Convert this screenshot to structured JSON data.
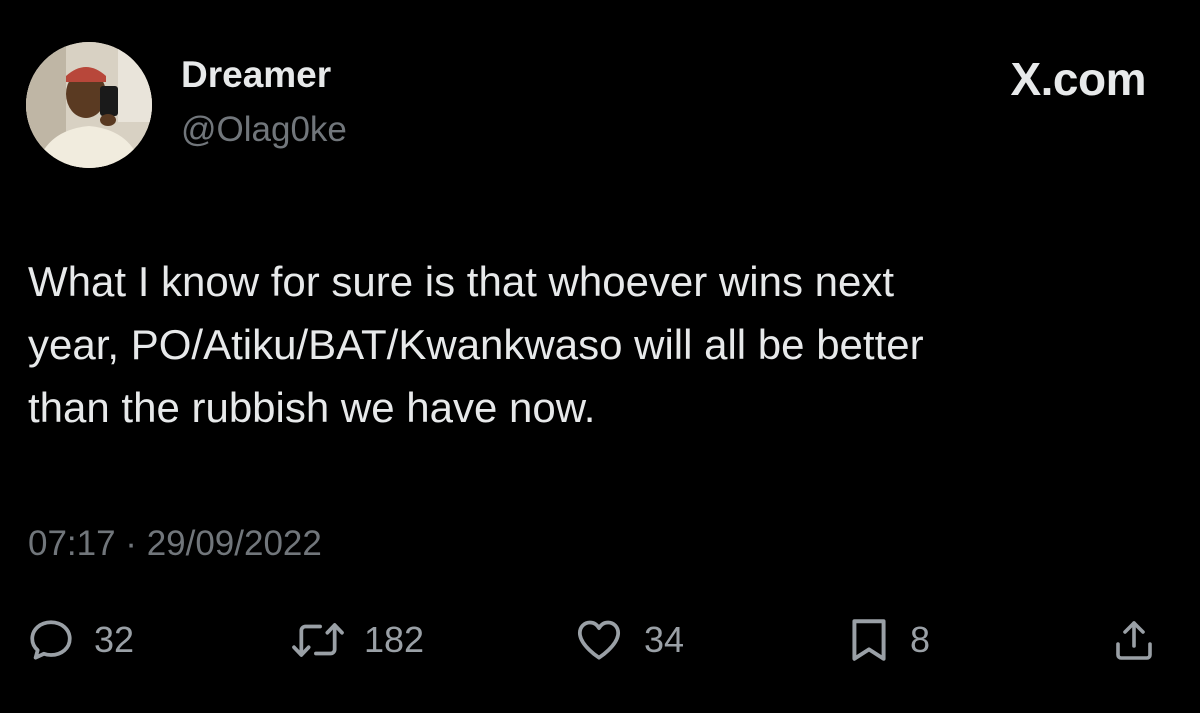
{
  "author": {
    "display_name": "Dreamer",
    "handle": "@Olag0ke",
    "avatar": "profile-photo"
  },
  "brand": {
    "label": "X.com"
  },
  "tweet": {
    "text": "What I know for sure is that whoever wins next\nyear, PO/Atiku/BAT/Kwankwaso will all be better\nthan the rubbish we have now.",
    "timestamp": "07:17 · 29/09/2022"
  },
  "actions": {
    "reply": {
      "icon": "reply-icon",
      "count": "32"
    },
    "retweet": {
      "icon": "retweet-icon",
      "count": "182"
    },
    "like": {
      "icon": "heart-icon",
      "count": "34"
    },
    "bookmark": {
      "icon": "bookmark-icon",
      "count": "8"
    },
    "share": {
      "icon": "share-icon"
    }
  },
  "colors": {
    "background": "#000000",
    "primary_text": "#e7e9ea",
    "secondary_text": "#71767b",
    "icon": "#9aa0a6"
  }
}
